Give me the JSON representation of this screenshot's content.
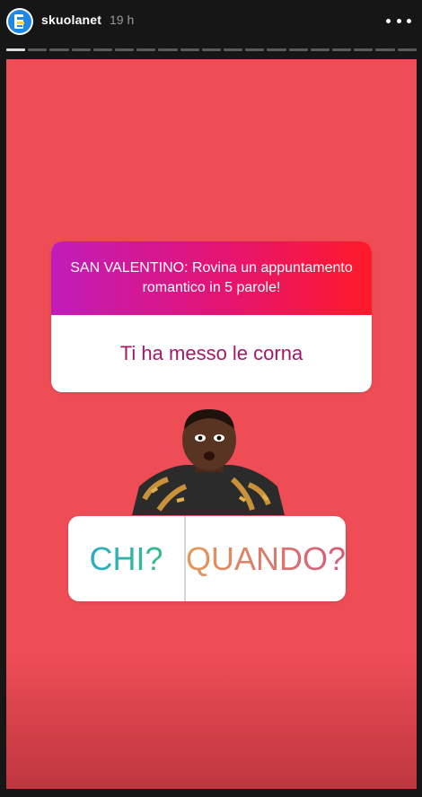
{
  "header": {
    "username": "skuolanet",
    "time": "19 h",
    "more_icon": "more-options-icon"
  },
  "progress": {
    "segments": 19,
    "active_index": 0
  },
  "story": {
    "background_color": "#ee4d55",
    "question": {
      "prompt": "SAN VALENTINO: Rovina un appuntamento romantico in 5 parole!",
      "answer": "Ti ha messo le corna"
    },
    "poll": {
      "options": [
        "CHI?",
        "QUANDO?"
      ]
    }
  }
}
